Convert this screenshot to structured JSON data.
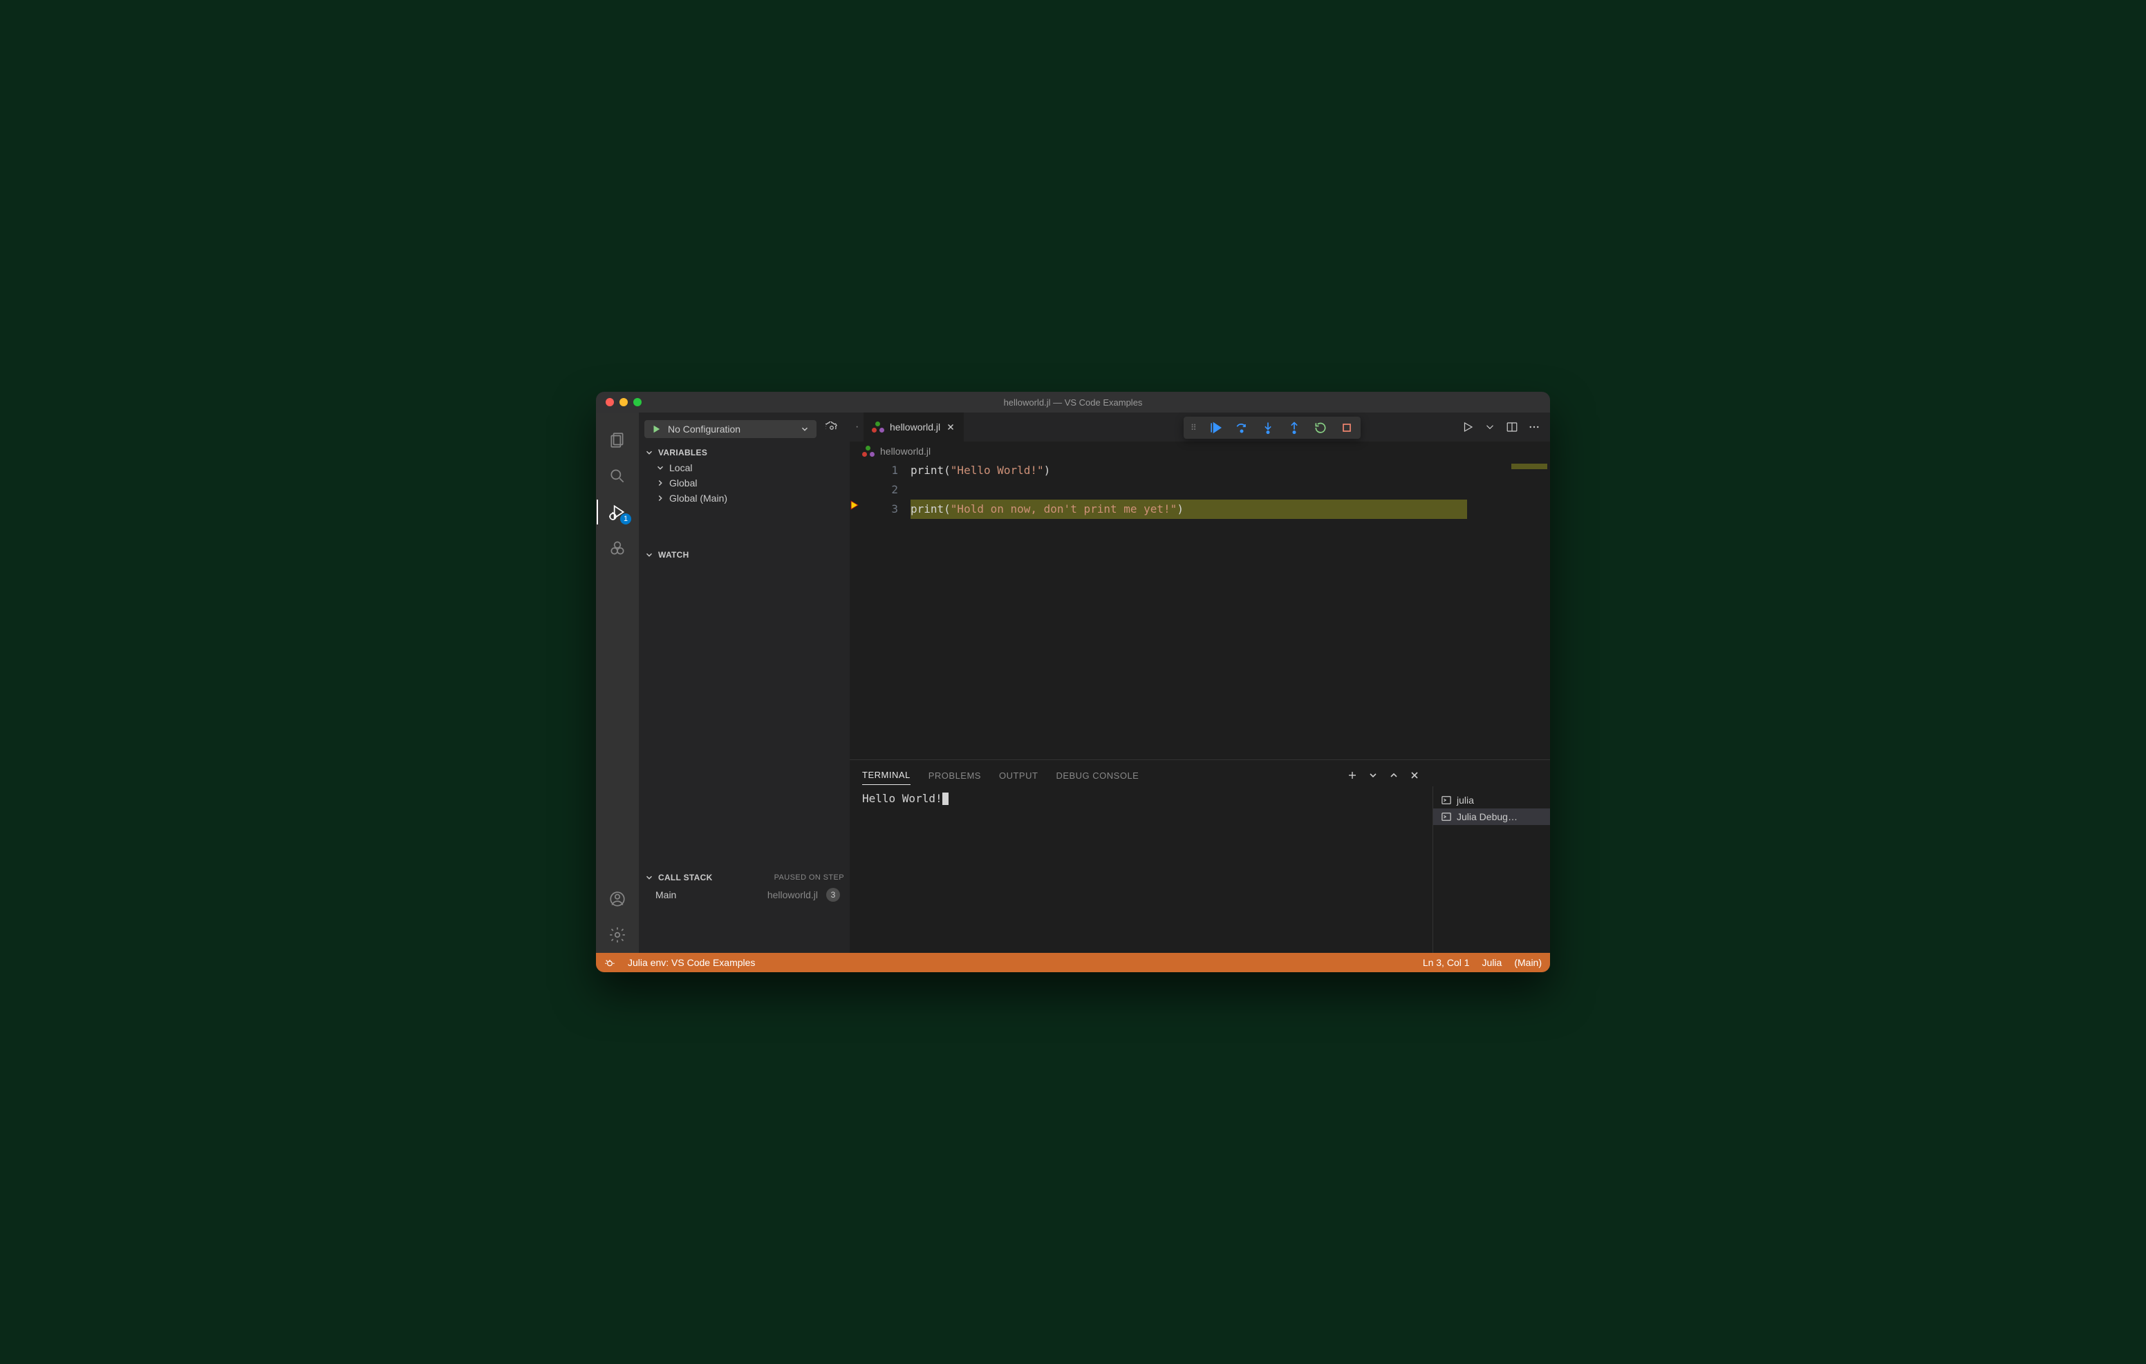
{
  "window": {
    "title": "helloworld.jl — VS Code Examples"
  },
  "debug": {
    "config_label": "No Configuration",
    "badge_count": "1",
    "pause_status": "PAUSED ON STEP"
  },
  "sections": {
    "variables": "VARIABLES",
    "watch": "WATCH",
    "callstack": "CALL STACK"
  },
  "variables_tree": [
    {
      "label": "Local",
      "expanded": true
    },
    {
      "label": "Global",
      "expanded": false
    },
    {
      "label": "Global (Main)",
      "expanded": false
    }
  ],
  "callstack": {
    "frame": "Main",
    "file": "helloworld.jl",
    "line": "3"
  },
  "tab": {
    "filename": "helloworld.jl",
    "modified_tooltip": "·"
  },
  "breadcrumb": {
    "filename": "helloworld.jl"
  },
  "editor": {
    "lines": [
      {
        "num": "1",
        "pre": "print(",
        "str": "\"Hello World!\"",
        "post": ")"
      },
      {
        "num": "2",
        "pre": "",
        "str": "",
        "post": ""
      },
      {
        "num": "3",
        "pre": "print(",
        "str": "\"Hold on now, don't print me yet!\"",
        "post": ")"
      }
    ],
    "current_line_index": 2
  },
  "panel": {
    "tabs": [
      "TERMINAL",
      "PROBLEMS",
      "OUTPUT",
      "DEBUG CONSOLE"
    ],
    "active_tab": 0,
    "terminal_output": "Hello World!",
    "terminals": [
      {
        "label": "julia",
        "active": false
      },
      {
        "label": "Julia Debug…",
        "active": true
      }
    ]
  },
  "statusbar": {
    "env": "Julia env: VS Code Examples",
    "position": "Ln 3, Col 1",
    "lang": "Julia",
    "scope": "(Main)"
  }
}
